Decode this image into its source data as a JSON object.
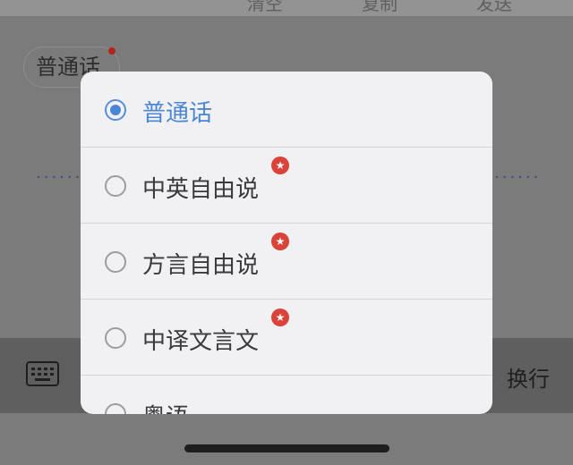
{
  "toolbar": {
    "clear_label": "清空",
    "copy_label": "复制",
    "send_label": "发送"
  },
  "mode_chip": {
    "label": "普通话"
  },
  "bottom_bar": {
    "keyboard_icon": "keyboard-icon",
    "newline_label": "换行"
  },
  "dialog": {
    "options": [
      {
        "label": "普通话",
        "selected": true,
        "badge": false
      },
      {
        "label": "中英自由说",
        "selected": false,
        "badge": true,
        "badge_icon": "star-icon"
      },
      {
        "label": "方言自由说",
        "selected": false,
        "badge": true,
        "badge_icon": "star-icon"
      },
      {
        "label": "中译文言文",
        "selected": false,
        "badge": true,
        "badge_icon": "star-icon"
      },
      {
        "label": "粤语",
        "selected": false,
        "badge": false
      }
    ]
  },
  "colors": {
    "accent": "#4a86d4",
    "badge": "#d9433a",
    "overlay": "#7b7b7b",
    "sheet": "#f1f1f3"
  }
}
